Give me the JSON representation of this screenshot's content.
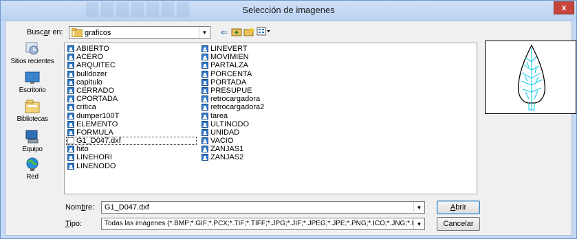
{
  "window": {
    "title": "Selección de imagenes",
    "close_label": "x"
  },
  "toolbar": {
    "lookin_label": "Buscar en:",
    "lookin_value": "graficos"
  },
  "places": [
    {
      "label": "Sitios recientes",
      "icon": "recent-places-icon"
    },
    {
      "label": "Escritorio",
      "icon": "desktop-icon"
    },
    {
      "label": "Bibliotecas",
      "icon": "libraries-icon"
    },
    {
      "label": "Equipo",
      "icon": "computer-icon"
    },
    {
      "label": "Red",
      "icon": "network-icon"
    }
  ],
  "files": {
    "col1": [
      "ABIERTO",
      "ACERO",
      "ARQUITEC",
      "bulldozer",
      "capitulo",
      "CERRADO",
      "CPORTADA",
      "critica",
      "dumper100T",
      "ELEMENTO",
      "FORMULA",
      "G1_D047.dxf",
      "hito",
      "LINEHORI",
      "LINENODO"
    ],
    "col2": [
      "LINEVERT",
      "MOVIMIEN",
      "PARTALZA",
      "PORCENTA",
      "PORTADA",
      "PRESUPUE",
      "retrocargadora",
      "retrocargadora2",
      "tarea",
      "ULTINODO",
      "UNIDAD",
      "VACIO",
      "ZANJAS1",
      "ZANJAS2"
    ]
  },
  "bottom": {
    "name_label": "Nombre:",
    "name_value": "G1_D047.dxf",
    "type_label": "Tipo:",
    "type_value": "Todas las imágenes (*.BMP;*.GIF;*.PCX;*.TIF;*.TIFF;*.JPG;*.JIF;*.JPEG;*.JPE;*.PNG;*.ICO;*.JNG;*.KOA;*.IFF;*.LBM;*.M",
    "open_label": "Abrir",
    "cancel_label": "Cancelar"
  },
  "colors": {
    "title_bg": "#b9d1f1",
    "close_bg": "#c7463c",
    "preview_stroke": "#000000",
    "preview_veins": "#00c8e6"
  }
}
